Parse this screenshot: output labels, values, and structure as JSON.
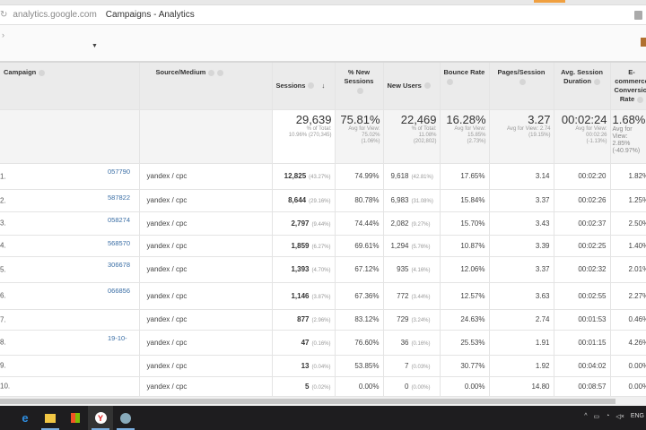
{
  "browser": {
    "url": "analytics.google.com",
    "title": "Campaigns - Analytics"
  },
  "columns": {
    "campaign": "Campaign",
    "source": "Source/Medium",
    "sessions": "Sessions",
    "new_sessions": "% New Sessions",
    "new_users": "New Users",
    "bounce": "Bounce Rate",
    "pages": "Pages/Session",
    "duration": "Avg. Session Duration",
    "ecom": "E-commerce Conversion Rate"
  },
  "summary": {
    "sessions": {
      "value": "29,639",
      "l1": "% of Total:",
      "l2": "10.96% (270,345)"
    },
    "new_sessions": {
      "value": "75.81%",
      "l1": "Avg for View:",
      "l2": "75.02%",
      "l3": "(1.06%)"
    },
    "new_users": {
      "value": "22,469",
      "l1": "% of Total:",
      "l2": "11.08%",
      "l3": "(202,802)"
    },
    "bounce": {
      "value": "16.28%",
      "l1": "Avg for View:",
      "l2": "15.85%",
      "l3": "(2.73%)"
    },
    "pages": {
      "value": "3.27",
      "l1": "Avg for View: 2.74",
      "l2": "(19.15%)"
    },
    "duration": {
      "value": "00:02:24",
      "l1": "Avg for View:",
      "l2": "00:02:26",
      "l3": "(-1.13%)"
    },
    "ecom": {
      "value": "1.68%",
      "l1": "Avg for",
      "l2": "View:",
      "l3": "2.85%",
      "l4": "(-40.97%)"
    }
  },
  "rows": [
    {
      "idx": "1.",
      "campaign": "057790",
      "source": "yandex / cpc",
      "sessions": "12,825",
      "sessions_pct": "(43.27%)",
      "new_sessions": "74.99%",
      "new_users": "9,618",
      "new_users_pct": "(42.81%)",
      "bounce": "17.65%",
      "pages": "3.14",
      "duration": "00:02:20",
      "ecom": "1.82%"
    },
    {
      "idx": "2.",
      "campaign": "587822",
      "source": "yandex / cpc",
      "sessions": "8,644",
      "sessions_pct": "(29.16%)",
      "new_sessions": "80.78%",
      "new_users": "6,983",
      "new_users_pct": "(31.08%)",
      "bounce": "15.84%",
      "pages": "3.37",
      "duration": "00:02:26",
      "ecom": "1.25%"
    },
    {
      "idx": "3.",
      "campaign": "058274",
      "source": "yandex / cpc",
      "sessions": "2,797",
      "sessions_pct": "(9.44%)",
      "new_sessions": "74.44%",
      "new_users": "2,082",
      "new_users_pct": "(9.27%)",
      "bounce": "15.70%",
      "pages": "3.43",
      "duration": "00:02:37",
      "ecom": "2.50%"
    },
    {
      "idx": "4.",
      "campaign": "568570",
      "source": "yandex / cpc",
      "sessions": "1,859",
      "sessions_pct": "(6.27%)",
      "new_sessions": "69.61%",
      "new_users": "1,294",
      "new_users_pct": "(5.76%)",
      "bounce": "10.87%",
      "pages": "3.39",
      "duration": "00:02:25",
      "ecom": "1.40%"
    },
    {
      "idx": "5.",
      "campaign": "306678",
      "source": "yandex / cpc",
      "sessions": "1,393",
      "sessions_pct": "(4.70%)",
      "new_sessions": "67.12%",
      "new_users": "935",
      "new_users_pct": "(4.16%)",
      "bounce": "12.06%",
      "pages": "3.37",
      "duration": "00:02:32",
      "ecom": "2.01%"
    },
    {
      "idx": "6.",
      "campaign": "066856",
      "source": "yandex / cpc",
      "sessions": "1,146",
      "sessions_pct": "(3.87%)",
      "new_sessions": "67.36%",
      "new_users": "772",
      "new_users_pct": "(3.44%)",
      "bounce": "12.57%",
      "pages": "3.63",
      "duration": "00:02:55",
      "ecom": "2.27%"
    },
    {
      "idx": "7.",
      "campaign": "",
      "source": "yandex / cpc",
      "sessions": "877",
      "sessions_pct": "(2.96%)",
      "new_sessions": "83.12%",
      "new_users": "729",
      "new_users_pct": "(3.24%)",
      "bounce": "24.63%",
      "pages": "2.74",
      "duration": "00:01:53",
      "ecom": "0.46%"
    },
    {
      "idx": "8.",
      "campaign": "19-10-",
      "source": "yandex / cpc",
      "sessions": "47",
      "sessions_pct": "(0.16%)",
      "new_sessions": "76.60%",
      "new_users": "36",
      "new_users_pct": "(0.16%)",
      "bounce": "25.53%",
      "pages": "1.91",
      "duration": "00:01:15",
      "ecom": "4.26%"
    },
    {
      "idx": "9.",
      "campaign": "",
      "source": "yandex / cpc",
      "sessions": "13",
      "sessions_pct": "(0.04%)",
      "new_sessions": "53.85%",
      "new_users": "7",
      "new_users_pct": "(0.03%)",
      "bounce": "30.77%",
      "pages": "1.92",
      "duration": "00:04:02",
      "ecom": "0.00%"
    },
    {
      "idx": "10.",
      "campaign": "",
      "source": "yandex / cpc",
      "sessions": "5",
      "sessions_pct": "(0.02%)",
      "new_sessions": "0.00%",
      "new_users": "0",
      "new_users_pct": "(0.00%)",
      "bounce": "0.00%",
      "pages": "14.80",
      "duration": "00:08:57",
      "ecom": "0.00%"
    }
  ],
  "taskbar": {
    "lang": "ENG"
  }
}
